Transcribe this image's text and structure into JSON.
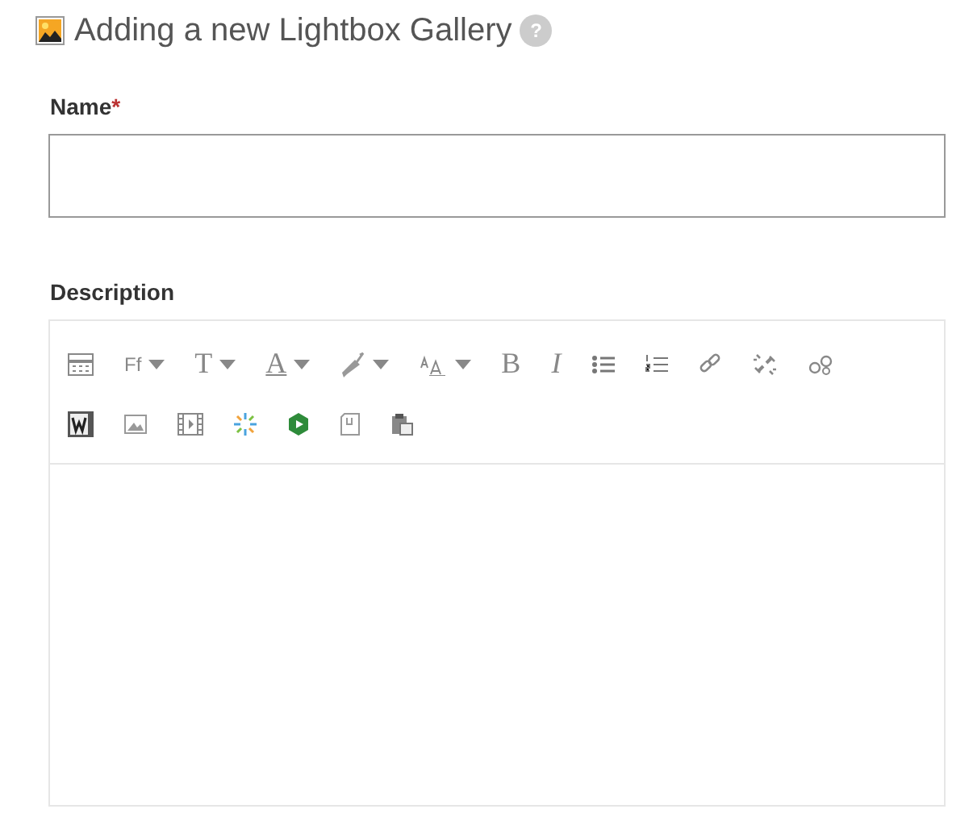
{
  "heading": {
    "title": "Adding a new Lightbox Gallery",
    "help": "?"
  },
  "fields": [
    {
      "label": "Name",
      "required_mark": "*",
      "kind": "input"
    },
    {
      "label": "Description",
      "kind": "editor"
    }
  ],
  "toolbar": [
    [
      {
        "kind": "icon",
        "dropdown": false
      },
      {
        "kind": "text",
        "label": "Ff",
        "dropdown": true
      },
      {
        "kind": "text",
        "label": "T",
        "dropdown": true
      },
      {
        "kind": "text",
        "label": "A",
        "dropdown": true
      },
      {
        "kind": "icon",
        "dropdown": true
      },
      {
        "kind": "icon",
        "dropdown": true
      },
      {
        "kind": "text",
        "label": "B",
        "dropdown": false
      },
      {
        "kind": "text",
        "label": "I",
        "dropdown": false
      },
      {
        "kind": "icon",
        "dropdown": false
      },
      {
        "kind": "icon",
        "dropdown": false
      },
      {
        "kind": "icon",
        "dropdown": false
      },
      {
        "kind": "icon",
        "dropdown": false
      },
      {
        "kind": "icon",
        "dropdown": false
      }
    ],
    [
      {
        "kind": "icon",
        "dropdown": false
      },
      {
        "kind": "icon",
        "dropdown": false
      },
      {
        "kind": "icon",
        "dropdown": false
      },
      {
        "kind": "icon",
        "dropdown": false
      },
      {
        "kind": "icon",
        "dropdown": false
      },
      {
        "kind": "icon",
        "dropdown": false
      },
      {
        "kind": "icon",
        "dropdown": false
      }
    ]
  ]
}
